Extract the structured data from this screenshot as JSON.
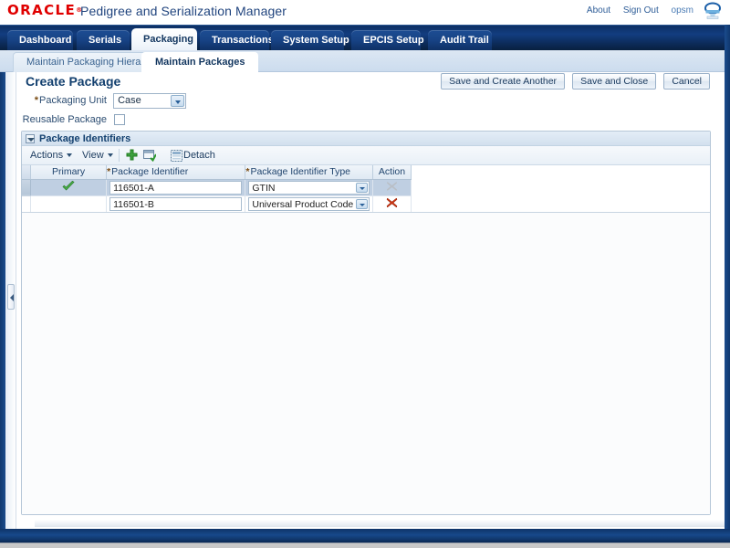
{
  "brand": {
    "logo_text": "ORACLE",
    "logo_tm": "®",
    "app_title": "Pedigree and Serialization Manager",
    "logo_color": "#e00000",
    "title_color": "#20447e"
  },
  "global_links": {
    "about": "About",
    "sign_out": "Sign Out",
    "user": "opsm",
    "screen_icon": "monitor-icon"
  },
  "tabs": [
    {
      "label": "Dashboard",
      "selected": false
    },
    {
      "label": "Serials",
      "selected": false
    },
    {
      "label": "Packaging",
      "selected": true
    },
    {
      "label": "Transactions",
      "selected": false
    },
    {
      "label": "System Setup",
      "selected": false
    },
    {
      "label": "EPCIS Setup",
      "selected": false
    },
    {
      "label": "Audit Trail",
      "selected": false
    }
  ],
  "subtabs": [
    {
      "label": "Maintain Packaging Hierarchy",
      "selected": false
    },
    {
      "label": "Maintain Packages",
      "selected": true
    }
  ],
  "page": {
    "title": "Create Package",
    "buttons": [
      {
        "label": "Save and Create Another",
        "name": "save-and-create-another-button"
      },
      {
        "label": "Save and Close",
        "name": "save-and-close-button"
      },
      {
        "label": "Cancel",
        "name": "cancel-button"
      }
    ]
  },
  "form": {
    "packaging_unit": {
      "label": "Packaging Unit",
      "required": true,
      "value": "Case"
    },
    "reusable_package": {
      "label": "Reusable Package",
      "checked": false
    }
  },
  "panel": {
    "title": "Package Identifiers",
    "disclosure_icon": "chevron-down-icon",
    "toolbar": {
      "actions_label": "Actions",
      "view_label": "View",
      "add_icon": "plus-icon",
      "duplicate_icon": "duplicate-row-icon",
      "detach_icon": "detach-icon",
      "detach_label": "Detach"
    },
    "table": {
      "columns": [
        {
          "label": "Primary",
          "required": false
        },
        {
          "label": "Package Identifier",
          "required": true
        },
        {
          "label": "Package Identifier Type",
          "required": true
        },
        {
          "label": "Action",
          "required": false
        }
      ],
      "rows": [
        {
          "selected": true,
          "primary": true,
          "primary_icon": "green-check-icon",
          "identifier": "116501-A",
          "identifier_type": "GTIN",
          "action_icon": "delete-x-icon-disabled",
          "action_enabled": false
        },
        {
          "selected": false,
          "primary": false,
          "primary_icon": "",
          "identifier": "116501-B",
          "identifier_type": "Universal Product Code",
          "action_icon": "delete-x-icon",
          "action_enabled": true
        }
      ]
    }
  },
  "colors": {
    "chrome_blue": "#0e3468",
    "tab_selected_bg": "#ffffff",
    "accent_link": "#2d5c97",
    "required_star": "#7a4b12",
    "row_selected": "#bfcfe2",
    "delete_red": "#cc3311",
    "check_green": "#3fa23f"
  }
}
